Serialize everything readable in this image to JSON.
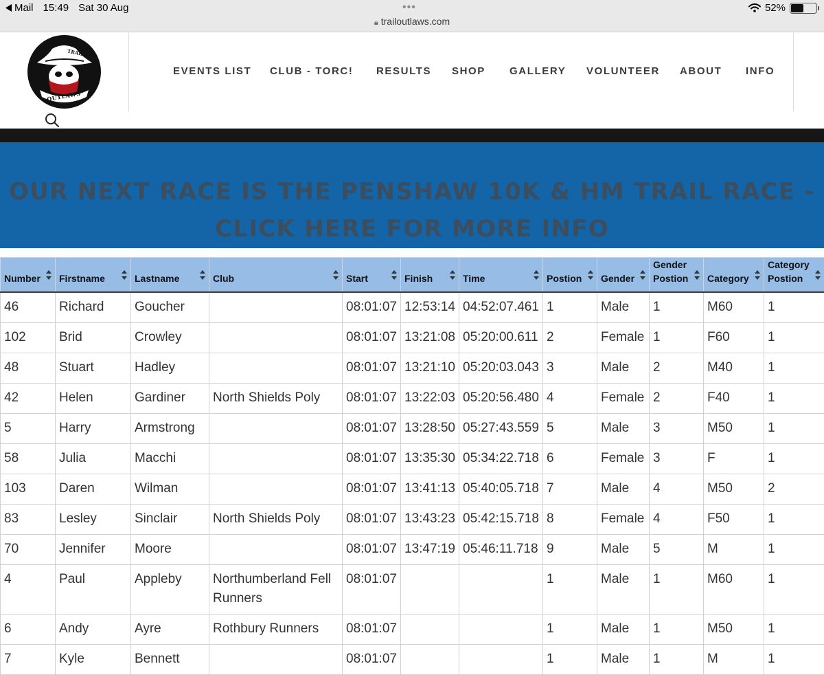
{
  "status_bar": {
    "back_app": "Mail",
    "time": "15:49",
    "date": "Sat 30 Aug",
    "url": "trailoutlaws.com",
    "battery": "52%",
    "battery_level": 0.52
  },
  "nav": {
    "items": [
      "EVENTS LIST",
      "CLUB - TORC!",
      "RESULTS",
      "SHOP",
      "GALLERY",
      "VOLUNTEER",
      "ABOUT",
      "INFO"
    ]
  },
  "logo": {
    "top_text": "TRAIL",
    "bottom_text": "OUTLAWS"
  },
  "banner": {
    "text": "OUR NEXT RACE IS THE PENSHAW 10K & HM TRAIL RACE - CLICK HERE FOR MORE INFO"
  },
  "colors": {
    "banner_bg": "#1465a8",
    "table_header_bg": "#97bde6"
  },
  "table": {
    "headers": [
      "Number",
      "Firstname",
      "Lastname",
      "Club",
      "Start",
      "Finish",
      "Time",
      "Postion",
      "Gender",
      "Gender Postion",
      "Category",
      "Category Postion"
    ],
    "rows": [
      [
        "46",
        "Richard",
        "Goucher",
        "",
        "08:01:07",
        "12:53:14",
        "04:52:07.461",
        "1",
        "Male",
        "1",
        "M60",
        "1"
      ],
      [
        "102",
        "Brid",
        "Crowley",
        "",
        "08:01:07",
        "13:21:08",
        "05:20:00.611",
        "2",
        "Female",
        "1",
        "F60",
        "1"
      ],
      [
        "48",
        "Stuart",
        "Hadley",
        "",
        "08:01:07",
        "13:21:10",
        "05:20:03.043",
        "3",
        "Male",
        "2",
        "M40",
        "1"
      ],
      [
        "42",
        "Helen",
        "Gardiner",
        "North Shields Poly",
        "08:01:07",
        "13:22:03",
        "05:20:56.480",
        "4",
        "Female",
        "2",
        "F40",
        "1"
      ],
      [
        "5",
        "Harry",
        "Armstrong",
        "",
        "08:01:07",
        "13:28:50",
        "05:27:43.559",
        "5",
        "Male",
        "3",
        "M50",
        "1"
      ],
      [
        "58",
        "Julia",
        "Macchi",
        "",
        "08:01:07",
        "13:35:30",
        "05:34:22.718",
        "6",
        "Female",
        "3",
        "F",
        "1"
      ],
      [
        "103",
        "Daren",
        "Wilman",
        "",
        "08:01:07",
        "13:41:13",
        "05:40:05.718",
        "7",
        "Male",
        "4",
        "M50",
        "2"
      ],
      [
        "83",
        "Lesley",
        "Sinclair",
        "North Shields Poly",
        "08:01:07",
        "13:43:23",
        "05:42:15.718",
        "8",
        "Female",
        "4",
        "F50",
        "1"
      ],
      [
        "70",
        "Jennifer",
        "Moore",
        "",
        "08:01:07",
        "13:47:19",
        "05:46:11.718",
        "9",
        "Male",
        "5",
        "M",
        "1"
      ],
      [
        "4",
        "Paul",
        "Appleby",
        "Northumberland Fell Runners",
        "08:01:07",
        "",
        "",
        "1",
        "Male",
        "1",
        "M60",
        "1"
      ],
      [
        "6",
        "Andy",
        "Ayre",
        "Rothbury Runners",
        "08:01:07",
        "",
        "",
        "1",
        "Male",
        "1",
        "M50",
        "1"
      ],
      [
        "7",
        "Kyle",
        "Bennett",
        "",
        "08:01:07",
        "",
        "",
        "1",
        "Male",
        "1",
        "M",
        "1"
      ]
    ]
  }
}
